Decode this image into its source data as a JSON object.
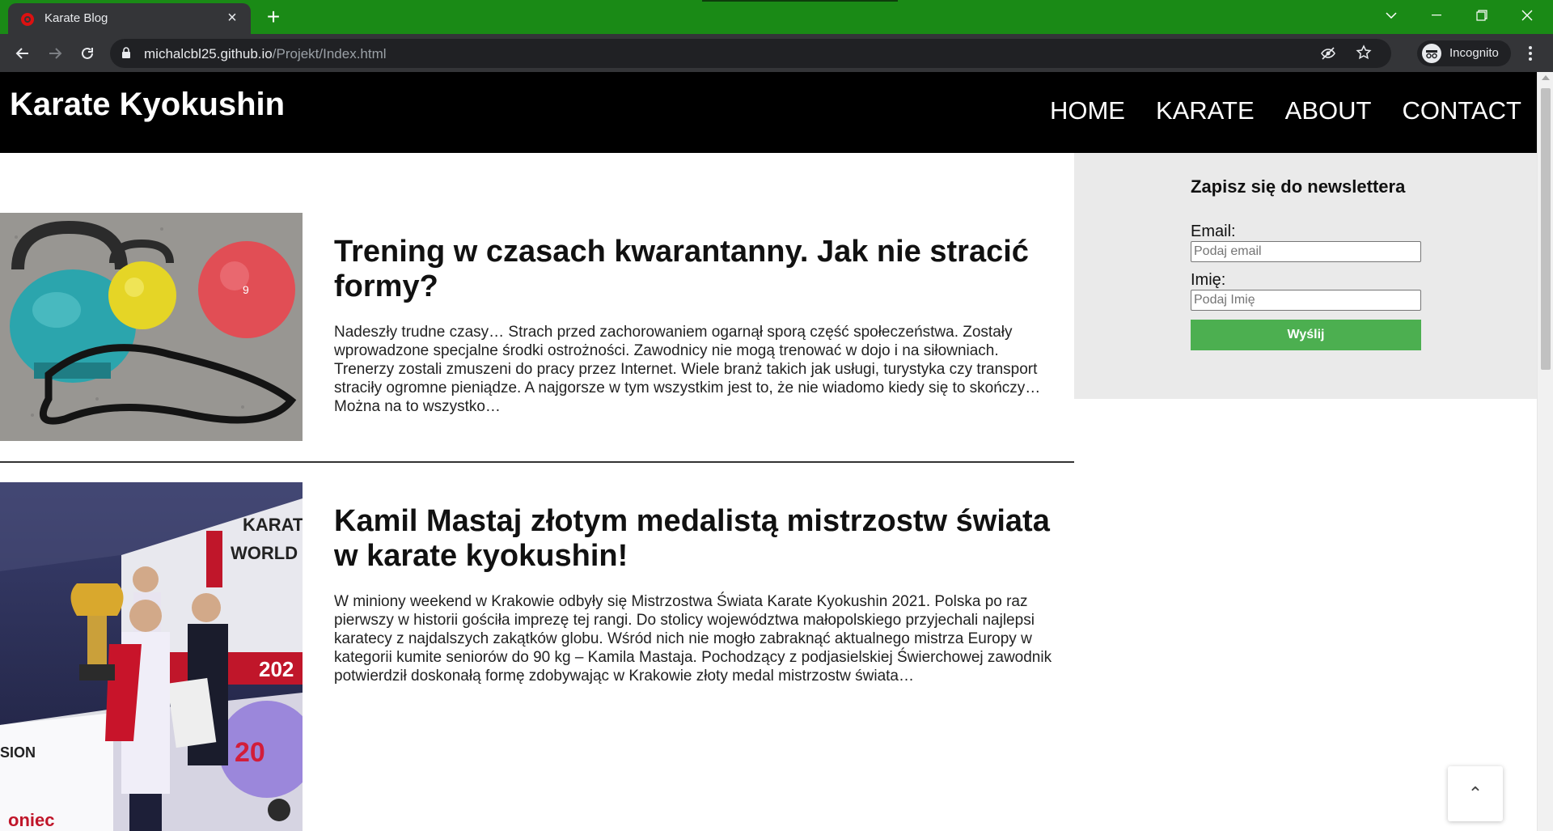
{
  "browser": {
    "tab_title": "Karate Blog",
    "url_host": "michalcbl25.github.io",
    "url_path": "/Projekt/Index.html",
    "profile_label": "Incognito",
    "frame_color": "#1a8a16"
  },
  "site": {
    "brand": "Karate Kyokushin",
    "nav": [
      "HOME",
      "KARATE",
      "ABOUT",
      "CONTACT"
    ]
  },
  "posts": [
    {
      "title": "Trening w czasach kwarantanny. Jak nie stracić formy?",
      "excerpt": "Nadeszły trudne czasy… Strach przed zachorowaniem ogarnął sporą część społeczeństwa. Zostały wprowadzone specjalne środki ostrożności. Zawodnicy nie mogą trenować w dojo i na siłowniach. Trenerzy zostali zmuszeni do pracy przez Internet. Wiele branż takich jak usługi, turystyka czy transport straciły ogromne pieniądze. A najgorsze w tym wszystkim jest to, że nie wiadomo kiedy się to skończy… Można na to wszystko…",
      "image": "kettlebells-training-photo"
    },
    {
      "title": "Kamil Mastaj złotym medalistą mistrzostw świata w karate kyokushin!",
      "excerpt": "W miniony weekend w Krakowie odbyły się Mistrzostwa Świata Karate Kyokushin 2021. Polska po raz pierwszy w historii gościła imprezę tej rangi. Do stolicy województwa małopolskiego przyjechali najlepsi karatecy z najdalszych zakątków globu. Wśród nich nie mogło zabraknąć aktualnego mistrza Europy w kategorii kumite seniorów do 90 kg – Kamila Mastaja. Pochodzący z podjasielskiej Świerchowej zawodnik potwierdził doskonałą formę zdobywając w Krakowie złoty medal mistrzostw świata…",
      "image": "world-championship-medal-photo"
    }
  ],
  "newsletter": {
    "heading": "Zapisz się do newslettera",
    "email_label": "Email:",
    "email_placeholder": "Podaj email",
    "name_label": "Imię:",
    "name_placeholder": "Podaj Imię",
    "submit_label": "Wyślij",
    "button_color": "#4caf50"
  },
  "back_to_top": "⌃"
}
